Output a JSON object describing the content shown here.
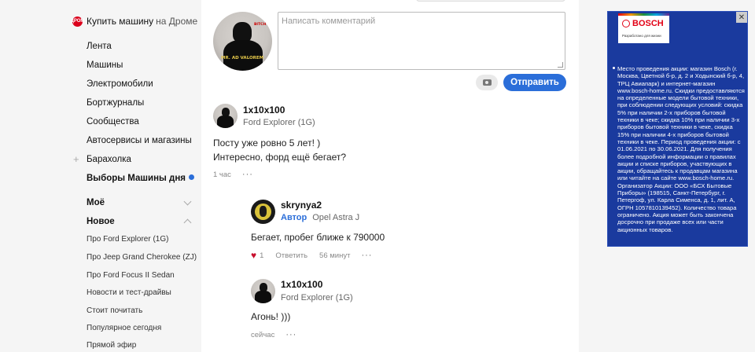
{
  "sidebar": {
    "drom_logo": "ДРОМ",
    "drom_bold": "Купить машину",
    "drom_rest": "на Дроме",
    "nav": [
      "Лента",
      "Машины",
      "Электромобили",
      "Бортжурналы",
      "Сообщества",
      "Автосервисы и магазины",
      "Барахолка",
      "Выборы Машины дня"
    ],
    "section_mine": "Моё",
    "section_new": "Новое",
    "sub": [
      "Про Ford Explorer (1G)",
      "Про Jeep Grand Cherokee (ZJ)",
      "Про Ford Focus II Sedan",
      "Новости и тест-драйвы",
      "Стоит почитать",
      "Популярное сегодня",
      "Прямой эфир"
    ]
  },
  "composer": {
    "placeholder": "Написать комментарий",
    "send_label": "Отправить",
    "avatar_caption": "MR. AD VALOREM",
    "avatar_tag": "BITCH"
  },
  "comments": [
    {
      "user": "1x10x100",
      "car": "Ford Explorer (1G)",
      "line1": "Посту уже ровно 5 лет! )",
      "line2": "Интересно, форд ещё бегает?",
      "time": "1 час",
      "more": "···"
    },
    {
      "user": "skrynya2",
      "badge": "Автор",
      "car": "Opel Astra J",
      "text": "Бегает, пробег ближе к 790000",
      "likes": "1",
      "reply": "Ответить",
      "time": "56 минут",
      "more": "···"
    },
    {
      "user": "1x10x100",
      "car": "Ford Explorer (1G)",
      "text": "Агонь! )))",
      "time": "сейчас",
      "more": "···"
    }
  ],
  "ad": {
    "close": "✕",
    "brand": "BOSCH",
    "tagline": "Разработано для жизни",
    "body": "Место проведения акции: магазин Bosch (г. Москва, Цветной б-р, д. 2 и Ходынский б-р, 4, ТРЦ Авиапарк) и интернет-магазин www.bosch-home.ru. Скидки предоставляются на определенные модели бытовой техники, при соблюдении следующих условий: скидка 5% при наличии 2-х приборов бытовой техники в чеке; скидка 10% при наличии 3-х приборов бытовой техники в чеке, скидка 15% при наличии 4-х приборов бытовой техники в чеке. Период проведения акции: с 01.06.2021 по 30.06.2021. Для получения более подробной информации о правилах акции и списке приборов, участвующих в акции, обращайтесь к продавцам магазина или читайте на сайте www.bosch-home.ru. Организатор Акции: ООО «БСХ Бытовые Приборы» (198515, Санкт-Петербург, г. Петергоф, ул. Карла Сименса, д. 1, лит. А, ОГРН 1057810139452). Количество товара ограничено. Акция может быть закончена досрочно при продаже всех или части акционных товаров."
  }
}
